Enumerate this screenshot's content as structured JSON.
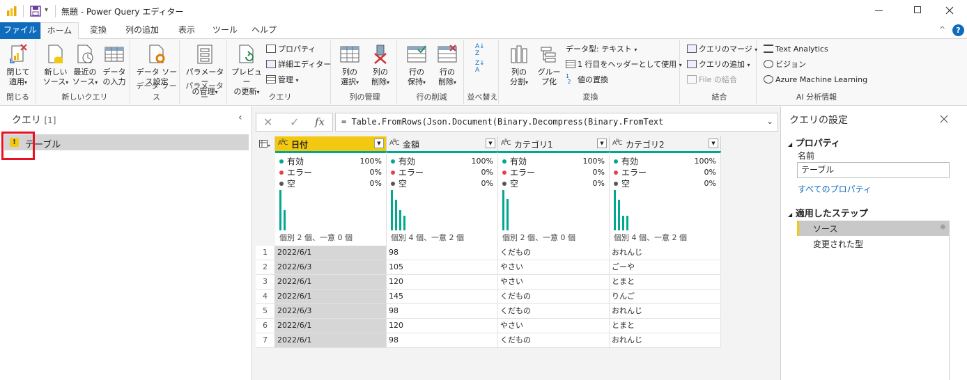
{
  "window": {
    "title": "無題 - Power Query エディター"
  },
  "menu": {
    "tabs": [
      "ファイル",
      "ホーム",
      "変換",
      "列の追加",
      "表示",
      "ツール",
      "ヘルプ"
    ],
    "active": "ホーム"
  },
  "ribbon": {
    "close": {
      "btn_l1": "閉じて",
      "btn_l2": "適用",
      "label": "閉じる"
    },
    "newquery": {
      "b1_l1": "新しい",
      "b1_l2": "ソース",
      "b2_l1": "最近の",
      "b2_l2": "ソース",
      "b3_l1": "データ",
      "b3_l2": "の入力",
      "label": "新しいクエリ"
    },
    "datasource": {
      "b1_l1": "データ ソー",
      "b1_l2": "ス設定",
      "label": "データ ソース"
    },
    "params": {
      "b1_l1": "パラメーター",
      "b1_l2": "の管理",
      "label": "パラメーター"
    },
    "query": {
      "b1_l1": "プレビュー",
      "b1_l2": "の更新",
      "s1": "プロパティ",
      "s2": "詳細エディター",
      "s3": "管理",
      "label": "クエリ"
    },
    "colmgmt": {
      "b1_l1": "列の",
      "b1_l2": "選択",
      "b2_l1": "列の",
      "b2_l2": "削除",
      "label": "列の管理"
    },
    "rowred": {
      "b1_l1": "行の",
      "b1_l2": "保持",
      "b2_l1": "行の",
      "b2_l2": "削除",
      "label": "行の削減"
    },
    "sort": {
      "label": "並べ替え"
    },
    "transform": {
      "b1_l1": "列の",
      "b1_l2": "分割",
      "b2_l1": "グルー",
      "b2_l2": "プ化",
      "s1": "データ型: テキスト",
      "s2": "1 行目をヘッダーとして使用",
      "s3": "値の置換",
      "label": "変換"
    },
    "combine": {
      "s1": "クエリのマージ",
      "s2": "クエリの追加",
      "s3": "File の結合",
      "label": "結合"
    },
    "ai": {
      "s1": "Text Analytics",
      "s2": "ビジョン",
      "s3": "Azure Machine Learning",
      "label": "AI 分析情報"
    }
  },
  "queries": {
    "header": "クエリ",
    "count": "[1]",
    "items": [
      {
        "name": "テーブル"
      }
    ]
  },
  "formula": "= Table.FromRows(Json.Document(Binary.Decompress(Binary.FromText",
  "table": {
    "columns": [
      {
        "name": "日付",
        "valid": "100%",
        "error": "0%",
        "empty": "0%",
        "distinct": "個別 2 個、一意 0 個",
        "bars": [
          1,
          0.5
        ]
      },
      {
        "name": "金額",
        "valid": "100%",
        "error": "0%",
        "empty": "0%",
        "distinct": "個別 4 個、一意 2 個",
        "bars": [
          1,
          0.75,
          0.5,
          0.37
        ]
      },
      {
        "name": "カテゴリ1",
        "valid": "100%",
        "error": "0%",
        "empty": "0%",
        "distinct": "個別 2 個、一意 0 個",
        "bars": [
          1,
          0.77
        ]
      },
      {
        "name": "カテゴリ2",
        "valid": "100%",
        "error": "0%",
        "empty": "0%",
        "distinct": "個別 4 個、一意 2 個",
        "bars": [
          1,
          0.75,
          0.37,
          0.37
        ]
      }
    ],
    "labels": {
      "valid": "有効",
      "error": "エラー",
      "empty": "空"
    },
    "rows": [
      [
        "1",
        "2022/6/1",
        "98",
        "くだもの",
        "おれんじ"
      ],
      [
        "2",
        "2022/6/3",
        "105",
        "やさい",
        "ごーや"
      ],
      [
        "3",
        "2022/6/1",
        "120",
        "やさい",
        "とまと"
      ],
      [
        "4",
        "2022/6/1",
        "145",
        "くだもの",
        "りんご"
      ],
      [
        "5",
        "2022/6/3",
        "98",
        "くだもの",
        "おれんじ"
      ],
      [
        "6",
        "2022/6/1",
        "120",
        "やさい",
        "とまと"
      ],
      [
        "7",
        "2022/6/1",
        "98",
        "くだもの",
        "おれんじ"
      ]
    ]
  },
  "settings": {
    "title": "クエリの設定",
    "properties": "プロパティ",
    "name_label": "名前",
    "name_value": "テーブル",
    "all_props": "すべてのプロパティ",
    "steps_title": "適用したステップ",
    "steps": [
      "ソース",
      "変更された型"
    ]
  },
  "colors": {
    "accent": "#0f6cbd",
    "teal": "#00a88f",
    "yellow": "#f2c811",
    "highlight": "#e81123"
  }
}
